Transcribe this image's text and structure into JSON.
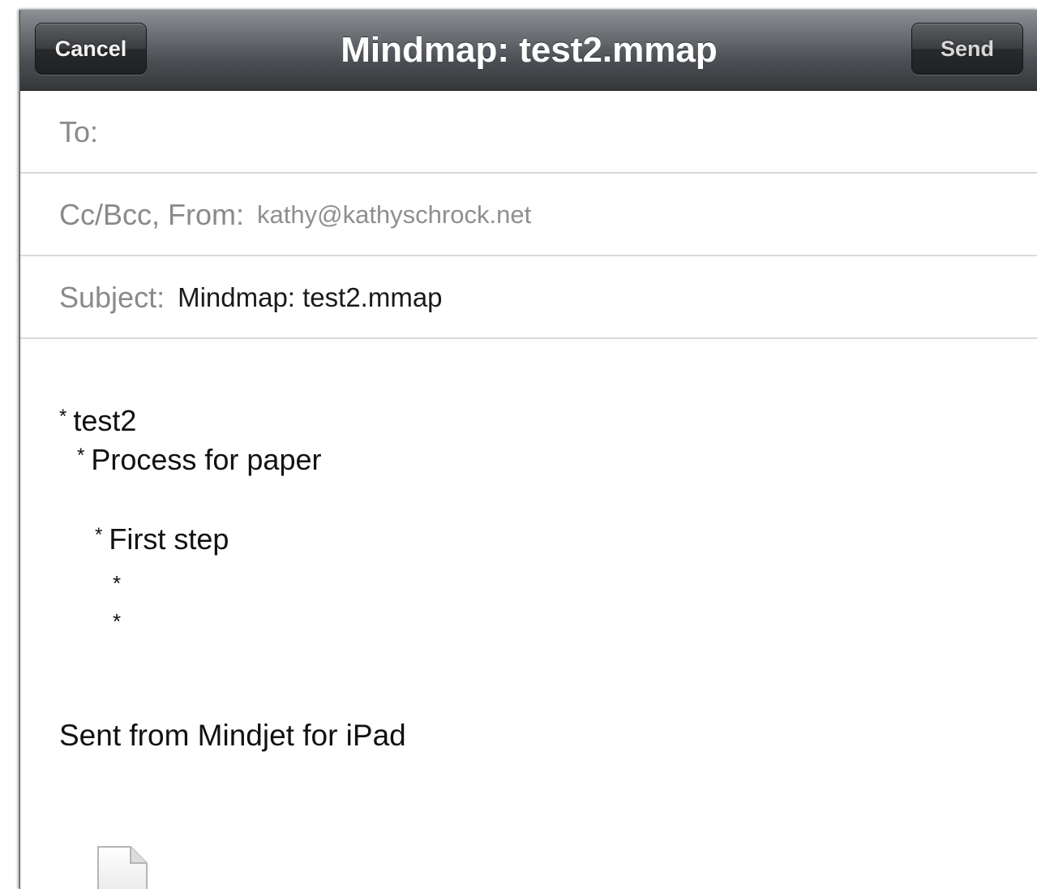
{
  "navbar": {
    "cancel_label": "Cancel",
    "title": "Mindmap: test2.mmap",
    "send_label": "Send"
  },
  "fields": {
    "to_label": "To:",
    "to_value": "",
    "from_label": "Cc/Bcc, From:",
    "from_value": "kathy@kathyschrock.net",
    "subject_label": "Subject:",
    "subject_value": "Mindmap: test2.mmap"
  },
  "body": {
    "bullet": "*",
    "lines": [
      {
        "text": "test2"
      },
      {
        "text": "Process for paper"
      },
      {
        "text": "First step"
      },
      {
        "text": ""
      },
      {
        "text": ""
      }
    ],
    "signature": "Sent from Mindjet for iPad"
  },
  "attachment": {
    "icon": "document-icon"
  },
  "colors": {
    "navbar_top": "#8d9196",
    "navbar_bottom": "#34373a",
    "label_gray": "#8a8a8a",
    "divider": "#d9d9d9"
  }
}
